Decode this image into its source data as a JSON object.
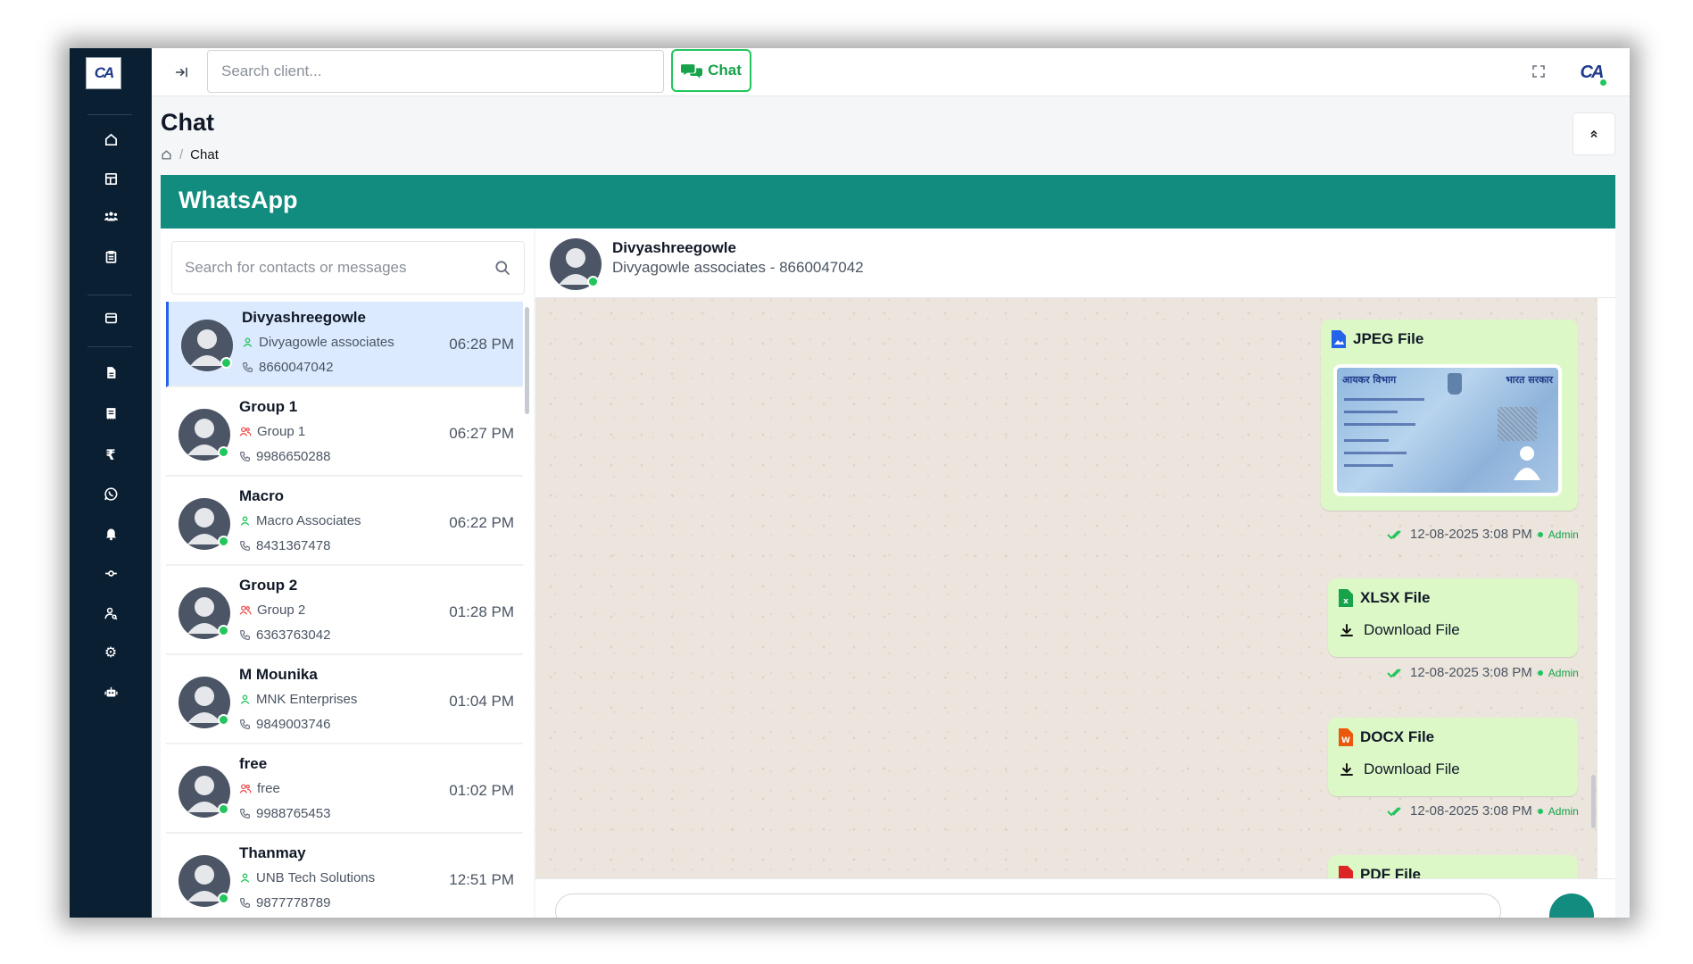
{
  "topbar": {
    "search_placeholder": "Search client...",
    "chat_button_label": "Chat",
    "logo_icon": "ca-india-logo",
    "fullscreen_icon": "fullscreen-icon"
  },
  "sidebar": {
    "logo": "CA",
    "items": [
      {
        "icon": "home-icon"
      },
      {
        "icon": "table-icon"
      },
      {
        "icon": "users-icon"
      },
      {
        "icon": "clipboard-icon"
      },
      {
        "icon": "card-icon"
      },
      {
        "icon": "document-icon"
      },
      {
        "icon": "receipt-icon"
      },
      {
        "icon": "rupee-icon"
      },
      {
        "icon": "whatsapp-icon"
      },
      {
        "icon": "bell-icon"
      },
      {
        "icon": "commit-icon"
      },
      {
        "icon": "user-key-icon"
      },
      {
        "icon": "gear-icon"
      },
      {
        "icon": "robot-icon"
      }
    ]
  },
  "page": {
    "title": "Chat",
    "breadcrumb": [
      "Chat"
    ]
  },
  "whatsapp": {
    "title": "WhatsApp",
    "accent_color": "#128c7e"
  },
  "contacts": {
    "search_placeholder": "Search for contacts or messages",
    "list": [
      {
        "name": "Divyashreegowle",
        "company": "Divyagowle associates",
        "phone": "8660047042",
        "time": "06:28 PM",
        "type": "user",
        "active": true
      },
      {
        "name": "Group 1",
        "company": "Group 1",
        "phone": "9986650288",
        "time": "06:27 PM",
        "type": "group",
        "active": false
      },
      {
        "name": "Macro",
        "company": "Macro Associates",
        "phone": "8431367478",
        "time": "06:22 PM",
        "type": "user",
        "active": false
      },
      {
        "name": "Group 2",
        "company": "Group 2",
        "phone": "6363763042",
        "time": "01:28 PM",
        "type": "group",
        "active": false
      },
      {
        "name": "M Mounika",
        "company": "MNK Enterprises",
        "phone": "9849003746",
        "time": "01:04 PM",
        "type": "user",
        "active": false
      },
      {
        "name": "free",
        "company": "free",
        "phone": "9988765453",
        "time": "01:02 PM",
        "type": "group",
        "active": false
      },
      {
        "name": "Thanmay",
        "company": "UNB Tech Solutions",
        "phone": "9877778789",
        "time": "12:51 PM",
        "type": "user",
        "active": false
      }
    ]
  },
  "chat": {
    "contact_name": "Divyashreegowle",
    "contact_sub": "Divyagowle associates - 8660047042",
    "messages": [
      {
        "title": "JPEG File",
        "timestamp": "12-08-2025 3:08 PM",
        "sender": "Admin",
        "image": {
          "left_top": "आयकर विभाग",
          "right_top": "भारत सरकार"
        }
      },
      {
        "title": "XLSX File",
        "download_label": "Download File",
        "timestamp": "12-08-2025 3:08 PM",
        "sender": "Admin"
      },
      {
        "title": "DOCX File",
        "download_label": "Download File",
        "timestamp": "12-08-2025 3:08 PM",
        "sender": "Admin"
      },
      {
        "title": "PDF File"
      }
    ]
  }
}
